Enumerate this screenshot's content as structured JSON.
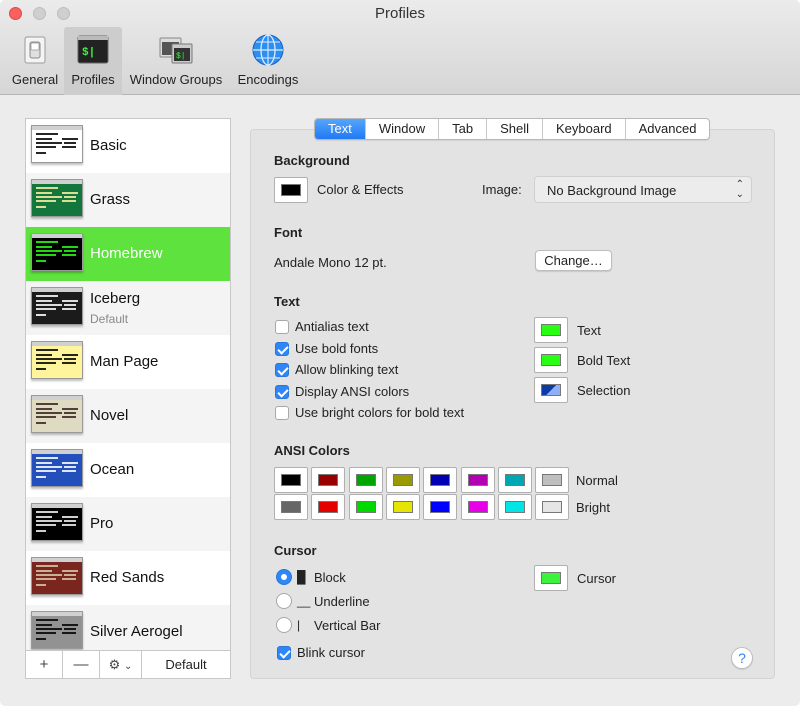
{
  "window": {
    "title": "Profiles"
  },
  "toolbar": [
    {
      "key": "general",
      "label": "General",
      "icon": "general-switch-icon",
      "selected": false
    },
    {
      "key": "profiles",
      "label": "Profiles",
      "icon": "terminal-icon",
      "selected": true
    },
    {
      "key": "window-groups",
      "label": "Window Groups",
      "icon": "window-groups-icon",
      "selected": false
    },
    {
      "key": "encodings",
      "label": "Encodings",
      "icon": "globe-icon",
      "selected": false
    }
  ],
  "profiles": [
    {
      "name": "Basic",
      "subtitle": "",
      "selected": false,
      "bg": "#ffffff",
      "fg": "#000000"
    },
    {
      "name": "Grass",
      "subtitle": "",
      "selected": false,
      "bg": "#13773d",
      "fg": "#fff0a5"
    },
    {
      "name": "Homebrew",
      "subtitle": "",
      "selected": true,
      "bg": "#000000",
      "fg": "#28fe14"
    },
    {
      "name": "Iceberg",
      "subtitle": "Default",
      "selected": false,
      "bg": "#1b1b1b",
      "fg": "#ffffff"
    },
    {
      "name": "Man Page",
      "subtitle": "",
      "selected": false,
      "bg": "#fef49c",
      "fg": "#000000"
    },
    {
      "name": "Novel",
      "subtitle": "",
      "selected": false,
      "bg": "#dfdbc3",
      "fg": "#3b2322"
    },
    {
      "name": "Ocean",
      "subtitle": "",
      "selected": false,
      "bg": "#224fbc",
      "fg": "#ffffff"
    },
    {
      "name": "Pro",
      "subtitle": "",
      "selected": false,
      "bg": "#000000",
      "fg": "#f2f2f2"
    },
    {
      "name": "Red Sands",
      "subtitle": "",
      "selected": false,
      "bg": "#7a251e",
      "fg": "#d7c9a7"
    },
    {
      "name": "Silver Aerogel",
      "subtitle": "",
      "selected": false,
      "bg": "#929292",
      "fg": "#000000"
    }
  ],
  "sidebar_bottom": {
    "add": "+",
    "remove": "—",
    "gear": "⚙",
    "default_label": "Default"
  },
  "tabs": [
    {
      "label": "Text",
      "selected": true
    },
    {
      "label": "Window",
      "selected": false
    },
    {
      "label": "Tab",
      "selected": false
    },
    {
      "label": "Shell",
      "selected": false
    },
    {
      "label": "Keyboard",
      "selected": false
    },
    {
      "label": "Advanced",
      "selected": false
    }
  ],
  "background": {
    "heading": "Background",
    "color_effects_label": "Color & Effects",
    "color": "#000000",
    "image_label": "Image:",
    "image_value": "No Background Image"
  },
  "font": {
    "heading": "Font",
    "value": "Andale Mono 12 pt.",
    "change_label": "Change…"
  },
  "text": {
    "heading": "Text",
    "options": [
      {
        "label": "Antialias text",
        "checked": false
      },
      {
        "label": "Use bold fonts",
        "checked": true
      },
      {
        "label": "Allow blinking text",
        "checked": true
      },
      {
        "label": "Display ANSI colors",
        "checked": true
      },
      {
        "label": "Use bright colors for bold text",
        "checked": false
      }
    ],
    "colors": [
      {
        "label": "Text",
        "color": "#28fe14"
      },
      {
        "label": "Bold Text",
        "color": "#28fe14"
      },
      {
        "label": "Selection",
        "color": "#0d3ba6"
      }
    ]
  },
  "ansi": {
    "heading": "ANSI Colors",
    "normal_label": "Normal",
    "bright_label": "Bright",
    "normal": [
      "#000000",
      "#990000",
      "#00a600",
      "#999900",
      "#0000b2",
      "#b200b2",
      "#00a6b2",
      "#bfbfbf"
    ],
    "bright": [
      "#666666",
      "#e50000",
      "#00d900",
      "#e5e500",
      "#0000ff",
      "#e500e5",
      "#00e5e5",
      "#e5e5e5"
    ]
  },
  "cursor": {
    "heading": "Cursor",
    "options": [
      {
        "glyph": "█",
        "label": "Block",
        "selected": true
      },
      {
        "glyph": "__",
        "label": "Underline",
        "selected": false
      },
      {
        "glyph": "|",
        "label": "Vertical Bar",
        "selected": false
      }
    ],
    "blink_label": "Blink cursor",
    "blink_checked": true,
    "color_label": "Cursor",
    "color": "#3cf23c"
  },
  "help_label": "?"
}
